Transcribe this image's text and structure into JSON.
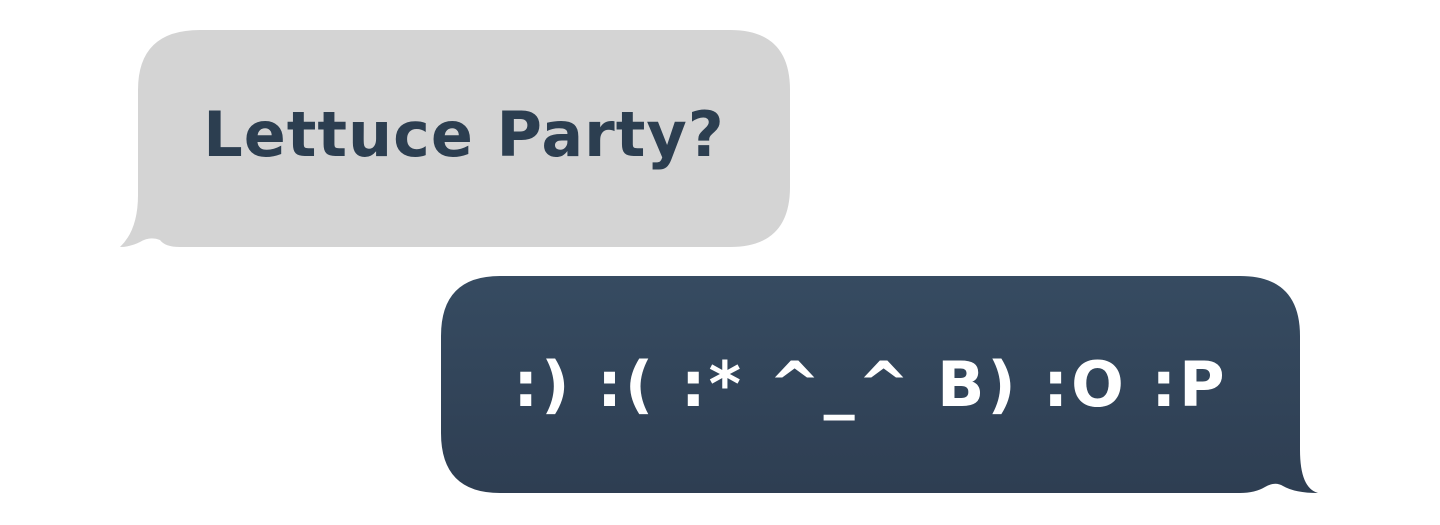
{
  "messages": [
    {
      "text": "Lettuce Party?",
      "side": "received",
      "bubble_color": "#d4d4d4",
      "text_color": "#2c3e50"
    },
    {
      "text": ":) :( :* ^_^ B) :O :P",
      "side": "sent",
      "bubble_color": "#324559",
      "text_color": "#ffffff"
    }
  ]
}
